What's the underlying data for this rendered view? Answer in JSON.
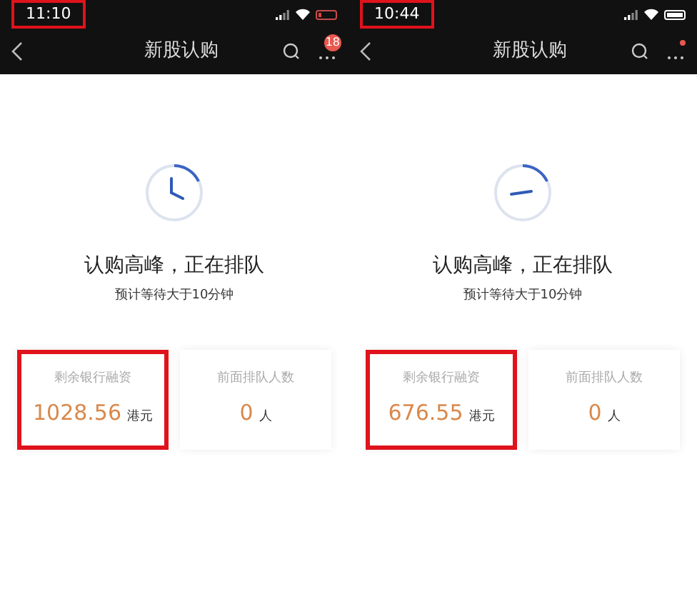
{
  "panels": [
    {
      "status_bar": {
        "time": "11:10",
        "time_highlighted": true,
        "battery_low": true
      },
      "nav": {
        "title": "新股认购",
        "notification": {
          "kind": "count",
          "text": "18"
        }
      },
      "clock": {
        "kind": "angle"
      },
      "heading": "认购高峰，正在排队",
      "subheading": "预计等待大于10分钟",
      "cards": [
        {
          "label": "剩余银行融资",
          "value": "1028.56",
          "unit": "港元",
          "highlighted": true
        },
        {
          "label": "前面排队人数",
          "value": "0",
          "unit": "人",
          "highlighted": false
        }
      ]
    },
    {
      "status_bar": {
        "time": "10:44",
        "time_highlighted": true,
        "battery_low": false
      },
      "nav": {
        "title": "新股认购",
        "notification": {
          "kind": "dot"
        }
      },
      "clock": {
        "kind": "flat"
      },
      "heading": "认购高峰，正在排队",
      "subheading": "预计等待大于10分钟",
      "cards": [
        {
          "label": "剩余银行融资",
          "value": "676.55",
          "unit": "港元",
          "highlighted": true
        },
        {
          "label": "前面排队人数",
          "value": "0",
          "unit": "人",
          "highlighted": false
        }
      ]
    }
  ]
}
